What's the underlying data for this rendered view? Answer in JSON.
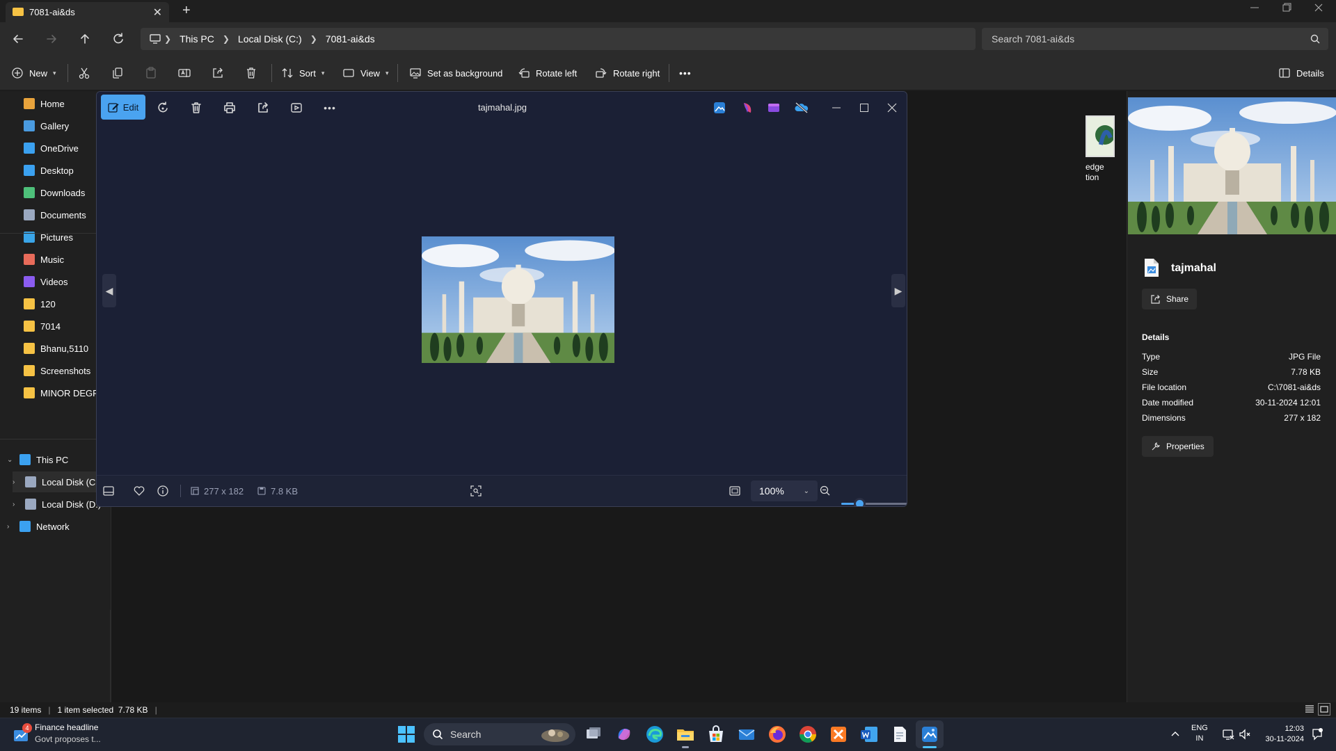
{
  "window": {
    "tab_title": "7081-ai&ds",
    "new_tab": "+",
    "tab_close": "✕"
  },
  "address": {
    "crumbs": [
      "This PC",
      "Local Disk (C:)",
      "7081-ai&ds"
    ],
    "search_placeholder": "Search 7081-ai&ds"
  },
  "toolbar": {
    "new": "New",
    "sort": "Sort",
    "view": "View",
    "set_background": "Set as background",
    "rotate_left": "Rotate left",
    "rotate_right": "Rotate right",
    "more": "•••",
    "details": "Details"
  },
  "sidebar": {
    "items": [
      {
        "label": "Home",
        "icon": "home-icon",
        "color": "#e8a33c"
      },
      {
        "label": "Gallery",
        "icon": "gallery-icon",
        "color": "#4a9be0"
      },
      {
        "label": "OneDrive",
        "icon": "onedrive-icon",
        "color": "#3ba1f0"
      },
      {
        "label": "Desktop",
        "icon": "desktop-icon",
        "color": "#3ba1f0"
      },
      {
        "label": "Downloads",
        "icon": "download-icon",
        "color": "#4ec07a"
      },
      {
        "label": "Documents",
        "icon": "documents-icon",
        "color": "#9aa8c0"
      },
      {
        "label": "Pictures",
        "icon": "pictures-icon",
        "color": "#3aa5e8"
      },
      {
        "label": "Music",
        "icon": "music-icon",
        "color": "#e86b5a"
      },
      {
        "label": "Videos",
        "icon": "videos-icon",
        "color": "#8b5cf0"
      },
      {
        "label": "120",
        "icon": "folder-icon",
        "color": "#f6c244"
      },
      {
        "label": "7014",
        "icon": "folder-icon",
        "color": "#f6c244"
      },
      {
        "label": "Bhanu,5110",
        "icon": "folder-icon",
        "color": "#f6c244"
      },
      {
        "label": "Screenshots",
        "icon": "folder-icon",
        "color": "#f6c244"
      },
      {
        "label": "MINOR DEGREE",
        "icon": "folder-icon",
        "color": "#f6c244"
      }
    ],
    "tree": [
      {
        "label": "This PC",
        "icon": "pc-icon",
        "chevron": "⌄"
      },
      {
        "label": "Local Disk (C:)",
        "icon": "drive-icon",
        "chevron": "›"
      },
      {
        "label": "Local Disk (D:)",
        "icon": "drive-icon",
        "chevron": "›"
      },
      {
        "label": "Network",
        "icon": "network-icon",
        "chevron": "›"
      }
    ]
  },
  "file_area": {
    "partial_item_text": [
      "edge",
      "tion"
    ]
  },
  "viewer": {
    "edit_label": "Edit",
    "title": "tajmahal.jpg",
    "dimensions": "277 x 182",
    "file_size": "7.8 KB",
    "zoom": "100%",
    "zoom_level": 0.2
  },
  "details_pane": {
    "file_name": "tajmahal",
    "share_label": "Share",
    "section_title": "Details",
    "rows": [
      {
        "key": "Type",
        "value": "JPG File"
      },
      {
        "key": "Size",
        "value": "7.78 KB"
      },
      {
        "key": "File location",
        "value": "C:\\7081-ai&ds"
      },
      {
        "key": "Date modified",
        "value": "30-11-2024 12:01"
      },
      {
        "key": "Dimensions",
        "value": "277 x 182"
      }
    ],
    "properties_label": "Properties"
  },
  "status": {
    "items_count": "19 items",
    "selection": "1 item selected  7.78 KB"
  },
  "taskbar": {
    "widget_title": "Finance headline",
    "widget_sub": "Govt proposes t...",
    "widget_badge": "4",
    "search_label": "Search",
    "lang_top": "ENG",
    "lang_bottom": "IN",
    "time": "12:03",
    "date": "30-11-2024"
  },
  "colors": {
    "accent": "#4aa3f0",
    "viewer_bg": "#1b2035",
    "folder": "#f6c244"
  }
}
